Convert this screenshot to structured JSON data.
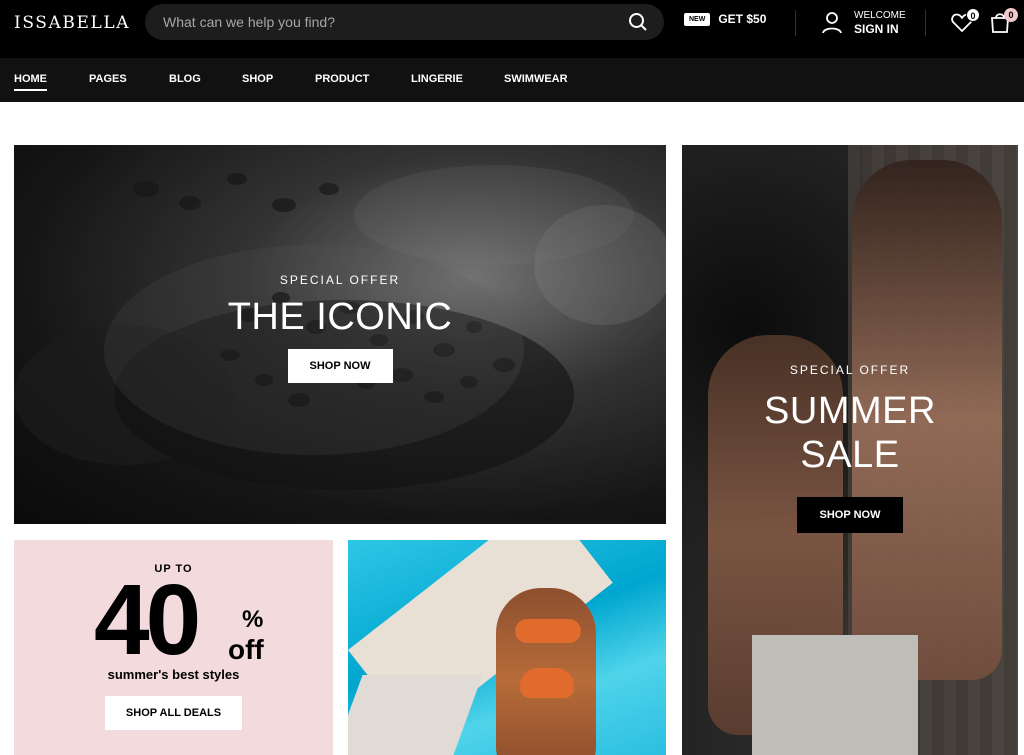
{
  "header": {
    "logo": "ISSABELLA",
    "search": {
      "placeholder": "What can we help you find?"
    },
    "promo": {
      "badge": "NEW",
      "label": "GET $50"
    },
    "account": {
      "welcome": "WELCOME",
      "signin": "SIGN IN"
    },
    "wishlist_count": "0",
    "cart_count": "0"
  },
  "nav": {
    "items": [
      {
        "label": "HOME"
      },
      {
        "label": "PAGES"
      },
      {
        "label": "BLOG"
      },
      {
        "label": "SHOP"
      },
      {
        "label": "PRODUCT"
      },
      {
        "label": "LINGERIE"
      },
      {
        "label": "SWIMWEAR"
      }
    ]
  },
  "hero_1": {
    "eyebrow": "SPECIAL OFFER",
    "title": "THE ICONIC",
    "button": "SHOP NOW"
  },
  "hero_2": {
    "eyebrow": "SPECIAL OFFER",
    "title_line_1": "SUMMER",
    "title_line_2": "SALE",
    "button": "SHOP NOW"
  },
  "deal": {
    "up_to": "UP TO",
    "number": "40",
    "percent": "%",
    "off": "off",
    "subtitle": "summer's best styles",
    "button": "SHOP ALL DEALS"
  },
  "icons": {
    "search": "search-icon",
    "user": "user-icon",
    "wishlist": "heart-icon",
    "cart": "shopping-bag-icon"
  },
  "colors": {
    "header": "#000000",
    "nav": "#111111",
    "promo_bg": "#f3dadd",
    "accent_badge": "#f2c8c8"
  }
}
